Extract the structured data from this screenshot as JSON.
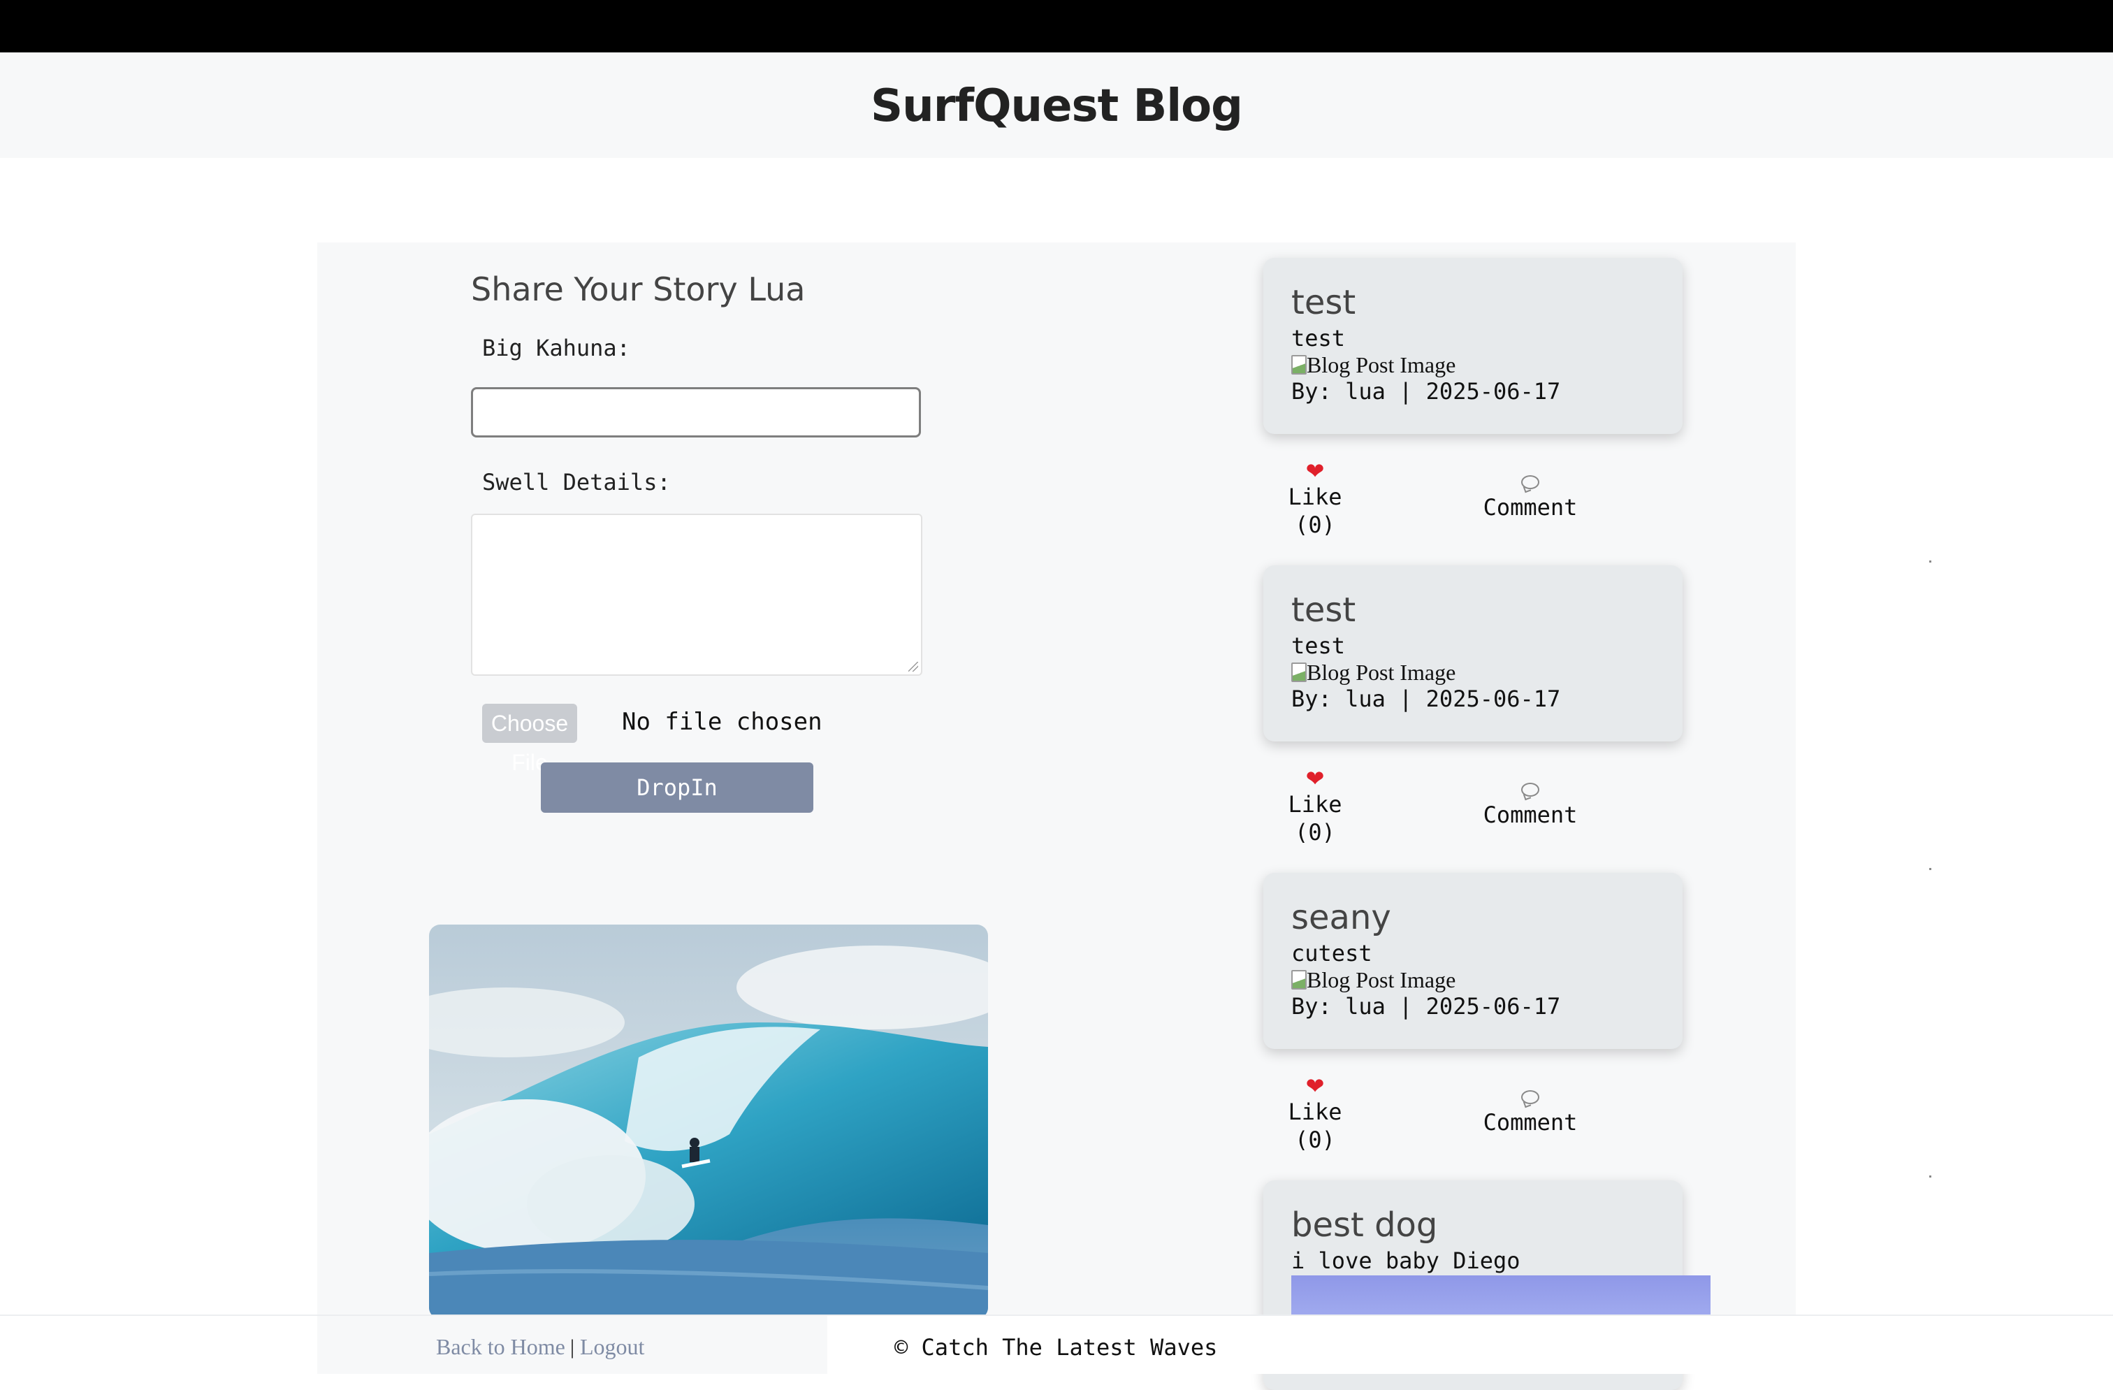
{
  "header": {
    "site_title": "SurfQuest Blog"
  },
  "form": {
    "title": "Share Your Story Lua",
    "title_label": "Big Kahuna:",
    "details_label": "Swell Details:",
    "file_button_label": "Choose File",
    "file_status": "No file chosen",
    "submit_label": "DropIn"
  },
  "posts": [
    {
      "title": "test",
      "body": "test",
      "image_alt": "Blog Post Image",
      "meta": "By: lua | 2025-06-17",
      "like_label": "Like",
      "like_count": "(0)",
      "comment_label": "Comment"
    },
    {
      "title": "test",
      "body": "test",
      "image_alt": "Blog Post Image",
      "meta": "By: lua | 2025-06-17",
      "like_label": "Like",
      "like_count": "(0)",
      "comment_label": "Comment"
    },
    {
      "title": "seany",
      "body": "cutest",
      "image_alt": "Blog Post Image",
      "meta": "By: lua | 2025-06-17",
      "like_label": "Like",
      "like_count": "(0)",
      "comment_label": "Comment"
    },
    {
      "title": "best dog",
      "body": "i love baby Diego"
    }
  ],
  "footer": {
    "home_link": "Back to Home",
    "separator": "|",
    "logout_link": "Logout",
    "copyright": "© Catch The Latest Waves"
  },
  "icons": {
    "like": "heart-icon",
    "comment": "speech-bubble-icon",
    "broken_image": "broken-image-icon"
  },
  "colors": {
    "accent": "#7f8ba4",
    "heart": "#e0202b",
    "topbar": "#000000"
  }
}
